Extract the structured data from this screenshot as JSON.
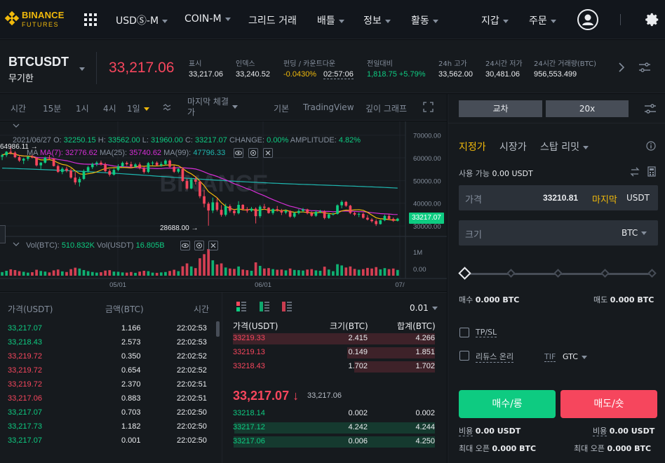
{
  "nav": {
    "logo_text": "BINANCE",
    "logo_sub": "FUTURES",
    "usds_m": "USDⓈ-M",
    "coin_m": "COIN-M",
    "grid_trade": "그리드 거래",
    "battle": "배틀",
    "info": "정보",
    "activity": "활동",
    "wallet": "지갑",
    "orders": "주문"
  },
  "ticker": {
    "symbol": "BTCUSDT",
    "symbol_sub": "무기한",
    "last_price": "33,217.06",
    "mark_label": "표시",
    "mark_value": "33,217.06",
    "index_label": "인덱스",
    "index_value": "33,240.52",
    "funding_label": "펀딩 / 카운트다운",
    "funding_rate": "-0.0430%",
    "countdown": "02:57:06",
    "change_label": "전일대비",
    "change_value": "1,818.75 +5.79%",
    "high_label": "24h 고가",
    "high_value": "33,562.00",
    "low_label": "24시간 저가",
    "low_value": "30,481.06",
    "vol_label": "24시간 거래량(BTC)",
    "vol_value": "956,553.499"
  },
  "chart_toolbar": {
    "time": "시간",
    "m15": "15분",
    "h1": "1시",
    "h4": "4시",
    "d1": "1일",
    "last_trade": "마지막 체결가",
    "basic": "기본",
    "tradingview": "TradingView",
    "depth": "깊이 그래프"
  },
  "chart_data": {
    "type": "candlestick",
    "legend_date": "2021/06/27",
    "open": "32250.15",
    "high": "33562.00",
    "low": "31960.00",
    "close": "33217.07",
    "change": "0.00%",
    "amplitude": "4.82%",
    "ma7_label": "MA(7):",
    "ma7": "32776.62",
    "ma25_label": "MA(25):",
    "ma25": "35740.62",
    "ma99_label": "MA(99):",
    "ma99": "47796.33",
    "ma_text": "MA",
    "y_ticks": [
      "70000.00",
      "60000.00",
      "50000.00",
      "40000.00",
      "30000.00"
    ],
    "ylim": [
      26000,
      73000
    ],
    "x_ticks": [
      "05/01",
      "06/01",
      "07/"
    ],
    "last_label": "33217.07",
    "max_label": "64986.11",
    "min_label": "28688.00",
    "vol_btc_label": "Vol(BTC):",
    "vol_btc": "510.832K",
    "vol_usdt_label": "Vol(USDT)",
    "vol_usdt": "16.805B",
    "vol_ticks": [
      "1M",
      "0.00"
    ],
    "watermark": "BINANCE",
    "candles": [
      [
        60500,
        61800,
        59000,
        61200
      ],
      [
        61200,
        63000,
        60400,
        62700
      ],
      [
        62700,
        64986,
        61500,
        62300
      ],
      [
        62300,
        62900,
        59900,
        60300
      ],
      [
        60300,
        61200,
        58200,
        58800
      ],
      [
        58800,
        60100,
        57300,
        59600
      ],
      [
        59600,
        60900,
        58700,
        60500
      ],
      [
        60500,
        61600,
        59800,
        60100
      ],
      [
        60100,
        60300,
        56200,
        56700
      ],
      [
        56700,
        58200,
        55100,
        57900
      ],
      [
        57900,
        60500,
        57500,
        60100
      ],
      [
        60100,
        61300,
        59200,
        59700
      ],
      [
        59700,
        59800,
        56200,
        56400
      ],
      [
        56400,
        57100,
        53400,
        53800
      ],
      [
        53800,
        55900,
        52800,
        55200
      ],
      [
        55200,
        56200,
        53600,
        54400
      ],
      [
        54400,
        55300,
        50800,
        51300
      ],
      [
        51300,
        53800,
        48200,
        49200
      ],
      [
        49200,
        51600,
        47400,
        50700
      ],
      [
        50700,
        54900,
        50300,
        54200
      ],
      [
        54200,
        56500,
        53400,
        55900
      ],
      [
        55900,
        57900,
        55100,
        57300
      ],
      [
        57300,
        58600,
        56300,
        57900
      ],
      [
        57900,
        58800,
        56600,
        57100
      ],
      [
        57100,
        57900,
        53700,
        54200
      ],
      [
        54200,
        55100,
        51800,
        52600
      ],
      [
        52600,
        55300,
        52200,
        54700
      ],
      [
        54700,
        57200,
        54100,
        56300
      ],
      [
        56300,
        58400,
        55800,
        57800
      ],
      [
        57800,
        58500,
        56500,
        57200
      ],
      [
        57200,
        58300,
        55400,
        56200
      ],
      [
        56200,
        57700,
        55600,
        57100
      ],
      [
        57100,
        58000,
        54900,
        55400
      ],
      [
        55400,
        56200,
        53100,
        53800
      ],
      [
        53800,
        58200,
        53300,
        57700
      ],
      [
        57700,
        58600,
        56700,
        57900
      ],
      [
        57900,
        58500,
        56300,
        56700
      ],
      [
        56700,
        58300,
        56100,
        57300
      ],
      [
        57300,
        59400,
        56800,
        58800
      ],
      [
        58800,
        59300,
        55600,
        56100
      ],
      [
        56100,
        56800,
        53400,
        53900
      ],
      [
        53900,
        55600,
        53200,
        55100
      ],
      [
        55100,
        55800,
        49400,
        49800
      ],
      [
        49800,
        50800,
        46000,
        46500
      ],
      [
        46500,
        51300,
        46200,
        50500
      ],
      [
        50500,
        51900,
        48300,
        49500
      ],
      [
        49500,
        50000,
        42200,
        43100
      ],
      [
        43100,
        45800,
        38200,
        39800
      ],
      [
        39800,
        40600,
        30100,
        36800
      ],
      [
        36800,
        42500,
        35700,
        40400
      ],
      [
        40400,
        42400,
        36400,
        37100
      ],
      [
        37100,
        39200,
        34100,
        34900
      ],
      [
        34900,
        39800,
        34200,
        38700
      ],
      [
        38700,
        39500,
        35900,
        36700
      ],
      [
        36700,
        37500,
        34600,
        35600
      ],
      [
        35600,
        40900,
        35100,
        39300
      ],
      [
        39300,
        39600,
        36800,
        37400
      ],
      [
        37400,
        38300,
        35800,
        36700
      ],
      [
        36700,
        38400,
        36200,
        37600
      ],
      [
        37600,
        38200,
        31100,
        34300
      ],
      [
        34300,
        39200,
        33500,
        38500
      ],
      [
        38500,
        39700,
        37100,
        38000
      ],
      [
        38000,
        38300,
        35400,
        35700
      ],
      [
        35700,
        37800,
        34900,
        37400
      ],
      [
        37400,
        38800,
        36300,
        36800
      ],
      [
        36800,
        37500,
        34800,
        35900
      ],
      [
        35900,
        37300,
        35200,
        36600
      ],
      [
        36600,
        36900,
        33600,
        34100
      ],
      [
        34100,
        36200,
        33500,
        35700
      ],
      [
        35700,
        37400,
        35100,
        36600
      ],
      [
        36600,
        37900,
        36000,
        37300
      ],
      [
        37300,
        37600,
        35100,
        35600
      ],
      [
        35600,
        36400,
        34100,
        34500
      ],
      [
        34500,
        36800,
        34000,
        36200
      ],
      [
        36200,
        37100,
        35600,
        36400
      ],
      [
        36400,
        36900,
        32900,
        33500
      ],
      [
        33500,
        35600,
        33100,
        35100
      ],
      [
        35100,
        35800,
        34600,
        35300
      ],
      [
        35300,
        39500,
        35000,
        39100
      ],
      [
        39100,
        41300,
        37800,
        40600
      ],
      [
        40600,
        41000,
        38400,
        38900
      ],
      [
        38900,
        39300,
        35200,
        35700
      ],
      [
        35700,
        36200,
        34400,
        35000
      ],
      [
        35000,
        35800,
        33900,
        35300
      ],
      [
        35300,
        35900,
        33200,
        33600
      ],
      [
        33600,
        34800,
        32400,
        32800
      ],
      [
        32800,
        33400,
        31500,
        32100
      ],
      [
        32100,
        32900,
        30000,
        30800
      ],
      [
        30800,
        32700,
        30600,
        32500
      ],
      [
        32500,
        35000,
        32100,
        34400
      ],
      [
        34400,
        35200,
        32600,
        33100
      ],
      [
        33100,
        33700,
        31800,
        32250
      ],
      [
        32250,
        33562,
        31960,
        33217
      ]
    ],
    "volumes": [
      35,
      48,
      62,
      55,
      44,
      38,
      30,
      34,
      58,
      46,
      40,
      32,
      52,
      60,
      42,
      36,
      64,
      78,
      70,
      55,
      44,
      36,
      30,
      34,
      50,
      54,
      40,
      38,
      32,
      30,
      36,
      28,
      40,
      48,
      44,
      30,
      28,
      32,
      36,
      46,
      58,
      44,
      92,
      120,
      90,
      74,
      170,
      210,
      260,
      150,
      110,
      120,
      80,
      70,
      66,
      90,
      60,
      54,
      48,
      130,
      96,
      70,
      74,
      64,
      58,
      60,
      52,
      70,
      56,
      54,
      50,
      60,
      64,
      52,
      48,
      88,
      60,
      44,
      112,
      100,
      80,
      90,
      66,
      58,
      64,
      76,
      70,
      84,
      62,
      74,
      64,
      70,
      56
    ]
  },
  "trades": {
    "price_header": "가격(USDT)",
    "amount_header": "금액(BTC)",
    "time_header": "시간",
    "rows": [
      {
        "price": "33,217.07",
        "amount": "1.166",
        "time": "22:02:53",
        "side": "up"
      },
      {
        "price": "33,218.43",
        "amount": "2.573",
        "time": "22:02:53",
        "side": "up"
      },
      {
        "price": "33,219.72",
        "amount": "0.350",
        "time": "22:02:52",
        "side": "down"
      },
      {
        "price": "33,219.72",
        "amount": "0.654",
        "time": "22:02:52",
        "side": "down"
      },
      {
        "price": "33,219.72",
        "amount": "2.370",
        "time": "22:02:51",
        "side": "down"
      },
      {
        "price": "33,217.06",
        "amount": "0.883",
        "time": "22:02:51",
        "side": "down"
      },
      {
        "price": "33,217.07",
        "amount": "0.703",
        "time": "22:02:50",
        "side": "up"
      },
      {
        "price": "33,217.73",
        "amount": "1.182",
        "time": "22:02:50",
        "side": "up"
      },
      {
        "price": "33,217.07",
        "amount": "0.001",
        "time": "22:02:50",
        "side": "up"
      }
    ]
  },
  "orderbook": {
    "precision": "0.01",
    "price_header": "가격(USDT)",
    "size_header": "크기(BTC)",
    "sum_header": "합계(BTC)",
    "asks": [
      {
        "price": "33219.33",
        "size": "2.415",
        "sum": "4.266"
      },
      {
        "price": "33219.13",
        "size": "0.149",
        "sum": "1.851"
      },
      {
        "price": "33218.43",
        "size": "1.702",
        "sum": "1.702"
      }
    ],
    "mid_price": "33,217.07",
    "mid_mark": "33,217.06",
    "bids": [
      {
        "price": "33218.14",
        "size": "0.002",
        "sum": "0.002"
      },
      {
        "price": "33217.12",
        "size": "4.242",
        "sum": "4.244"
      },
      {
        "price": "33217.06",
        "size": "0.006",
        "sum": "4.250"
      }
    ]
  },
  "panel": {
    "cross": "교차",
    "leverage": "20x",
    "tab_limit": "지정가",
    "tab_market": "시장가",
    "tab_stop": "스탑 리밋",
    "available_label": "사용 가능",
    "available_value": "0.00 USDT",
    "price_label": "가격",
    "price_value": "33210.81",
    "last_btn": "마지막",
    "price_unit": "USDT",
    "size_label": "크기",
    "size_unit": "BTC",
    "buy_label": "매수",
    "buy_value": "0.000 BTC",
    "sell_label": "매도",
    "sell_value": "0.000 BTC",
    "tpsl": "TP/SL",
    "reduce_only": "리듀스 온리",
    "tif_label": "TIF",
    "tif_value": "GTC",
    "buy_btn": "매수/롱",
    "sell_btn": "매도/숏",
    "cost_label": "비용",
    "cost_buy": "0.00 USDT",
    "cost_sell": "0.00 USDT",
    "max_label": "최대 오픈",
    "max_buy": "0.000 BTC",
    "max_sell": "0.000 BTC"
  },
  "colors": {
    "up": "#0ecb81",
    "down": "#f6465d",
    "accent": "#f0b90b",
    "ma7": "#f0b90b",
    "ma25": "#d62fd6",
    "ma99": "#1fb7b0"
  }
}
